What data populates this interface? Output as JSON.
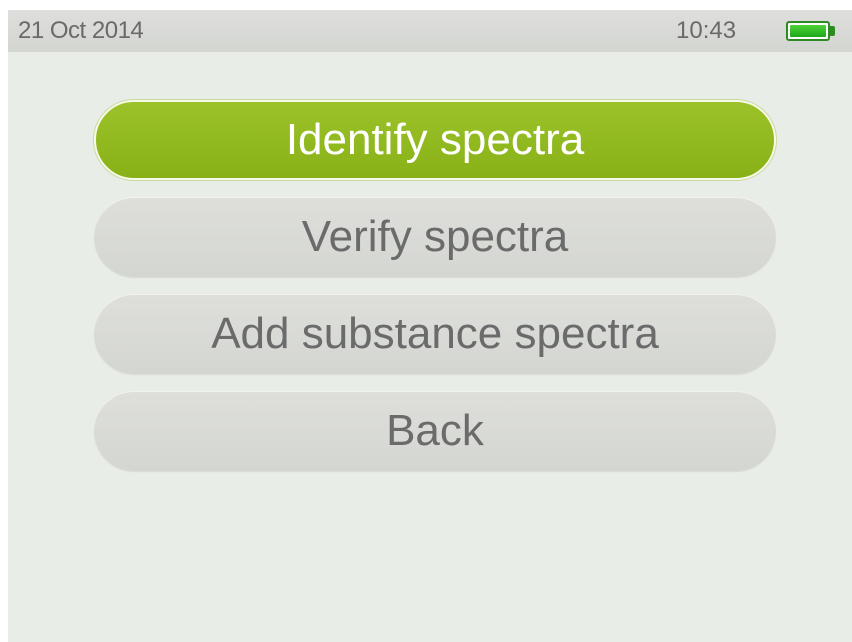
{
  "status_bar": {
    "date": "21 Oct 2014",
    "time": "10:43",
    "battery_icon": "battery-full-icon",
    "battery_level": 1.0,
    "battery_color": "#2e8a22"
  },
  "menu": {
    "items": [
      {
        "label": "Identify spectra",
        "selected": true
      },
      {
        "label": "Verify spectra",
        "selected": false
      },
      {
        "label": "Add substance spectra",
        "selected": false
      },
      {
        "label": "Back",
        "selected": false
      }
    ]
  },
  "colors": {
    "selected": "#94bb22",
    "unselected": "#d9dbd7",
    "background": "#e9ede8"
  }
}
